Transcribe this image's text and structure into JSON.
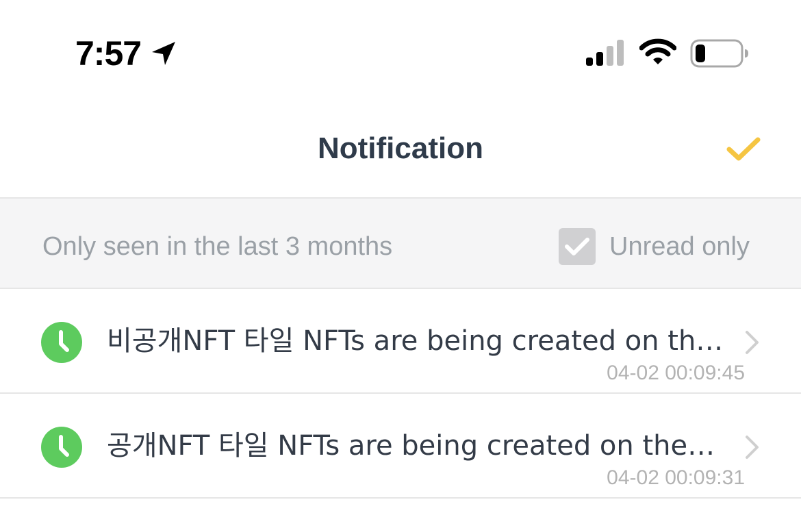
{
  "status_bar": {
    "time": "7:57",
    "icons": [
      "location-arrow-icon",
      "cellular-signal-icon",
      "wifi-icon",
      "battery-icon"
    ]
  },
  "header": {
    "title": "Notification",
    "action_icon": "checkmark-icon",
    "accent_color": "#F5C542"
  },
  "filter": {
    "note": "Only seen in the last 3 months",
    "unread_label": "Unread only",
    "unread_checked": true
  },
  "notifications": [
    {
      "text": "비공개NFT 타일 NFTs are being created on th…",
      "time": "04-02 00:09:45",
      "icon": "clock-icon",
      "icon_color": "#5DCB5E"
    },
    {
      "text": "공개NFT 타일 NFTs are being created on the…",
      "time": "04-02 00:09:31",
      "icon": "clock-icon",
      "icon_color": "#5DCB5E"
    }
  ]
}
